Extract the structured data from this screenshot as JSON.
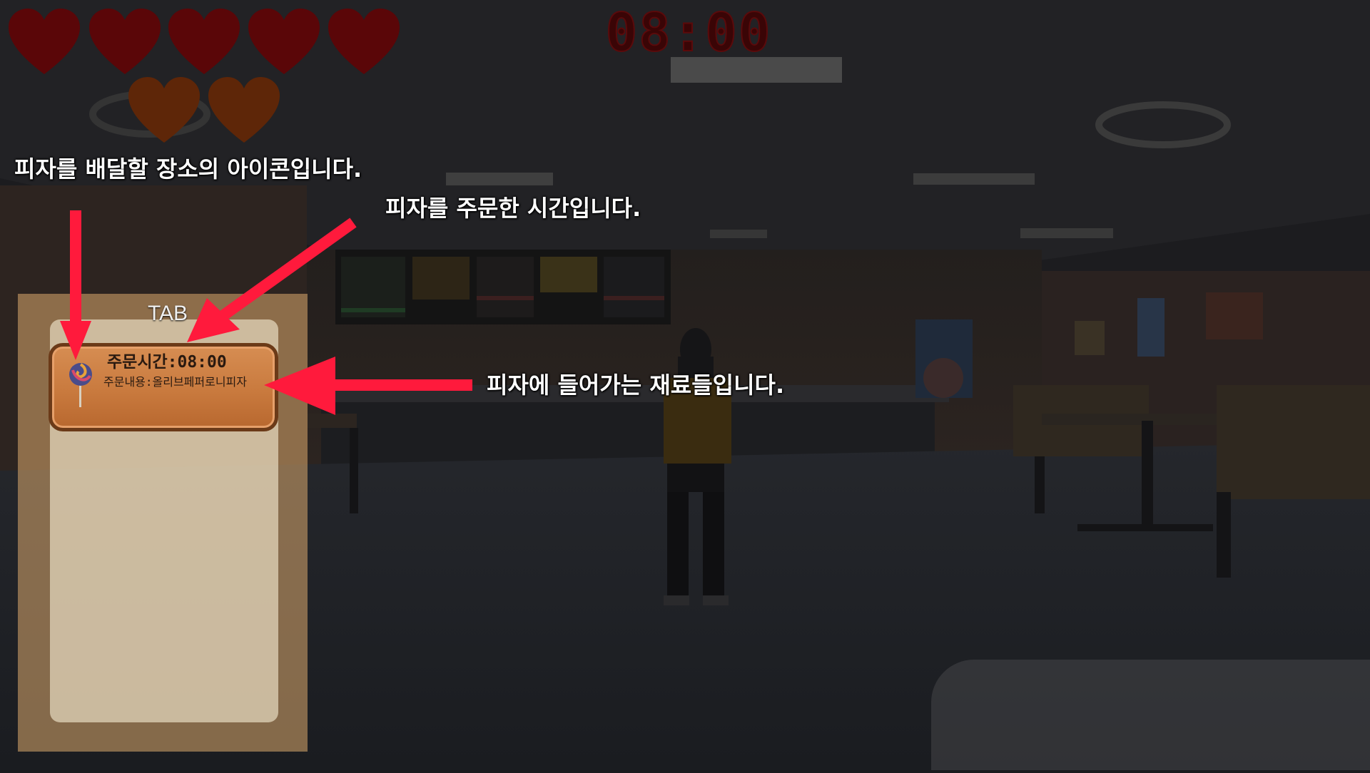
{
  "hud": {
    "hearts_full": 5,
    "hearts_bonus": 2,
    "timer": "08:00",
    "colors": {
      "heart_full": "#5a0608",
      "heart_bonus": "#5e2608",
      "timer": "#3a0506"
    }
  },
  "tab_panel": {
    "label": "TAB",
    "order": {
      "icon": "lollipop-icon",
      "time_text": "주문시간:08:00",
      "content_text": "주문내용:올리브페퍼로니피자"
    }
  },
  "annotations": {
    "icon_caption": "피자를 배달할 장소의 아이콘입니다.",
    "time_caption": "피자를 주문한 시간입니다.",
    "ingredients_caption": "피자에 들어가는 재료들입니다.",
    "arrow_color": "#ff1a3c"
  }
}
